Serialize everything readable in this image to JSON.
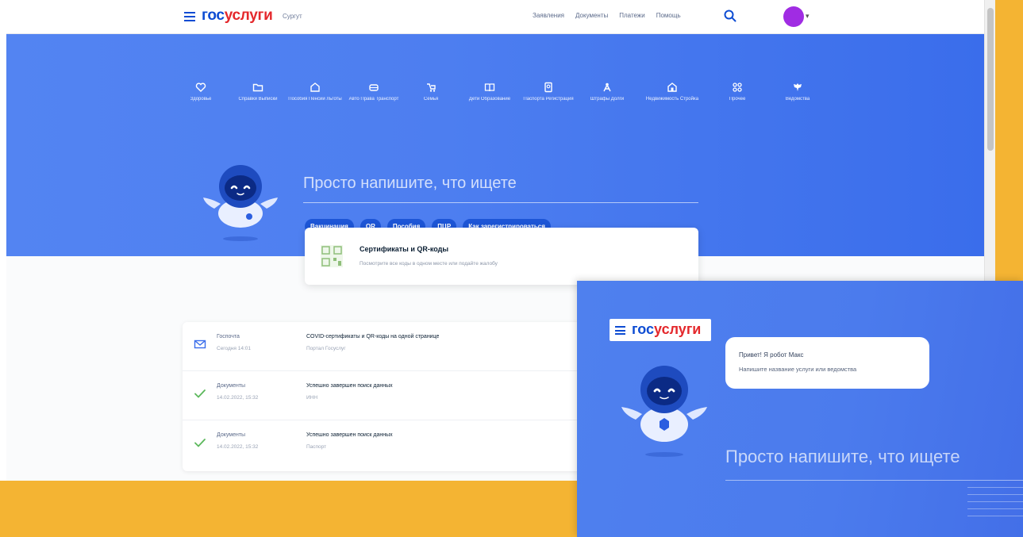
{
  "header": {
    "logo_part1": "гос",
    "logo_part2": "услуги",
    "city": "Сургут",
    "nav": [
      "Заявления",
      "Документы",
      "Платежи",
      "Помощь"
    ]
  },
  "categories": [
    {
      "label": "Здоровье",
      "icon": "heart-icon"
    },
    {
      "label": "Справки Выписки",
      "icon": "folder-icon"
    },
    {
      "label": "Пособия Пенсии Льготы",
      "icon": "house-icon"
    },
    {
      "label": "Авто Права Транспорт",
      "icon": "car-icon"
    },
    {
      "label": "Семья",
      "icon": "stroller-icon"
    },
    {
      "label": "Дети Образование",
      "icon": "book-icon"
    },
    {
      "label": "Паспорта Регистрация",
      "icon": "passport-icon"
    },
    {
      "label": "Штрафы Долги",
      "icon": "fine-icon"
    },
    {
      "label": "Недвижимость Стройка",
      "icon": "building-icon"
    },
    {
      "label": "Прочее",
      "icon": "grid-icon"
    },
    {
      "label": "Ведомства",
      "icon": "emblem-icon"
    }
  ],
  "hero": {
    "search_prompt": "Просто напишите, что ищете",
    "chips": [
      "Вакцинация",
      "QR",
      "Пособия",
      "ПЦР",
      "Как зарегистрироваться"
    ]
  },
  "cert_card": {
    "title": "Сертификаты и QR-коды",
    "subtitle": "Посмотрите все коды в одном месте или подайте жалобу"
  },
  "feed": [
    {
      "source": "Госпочта",
      "time": "Сегодня 14:01",
      "title": "COVID-сертификаты и QR-коды на одной странице",
      "subtitle": "Портал Госуслуг",
      "icon": "mail-icon"
    },
    {
      "source": "Документы",
      "time": "14.02.2022, 15:32",
      "title": "Успешно завершен поиск данных",
      "subtitle": "ИНН",
      "icon": "check-icon"
    },
    {
      "source": "Документы",
      "time": "14.02.2022, 15:32",
      "title": "Успешно завершен поиск данных",
      "subtitle": "Паспорт",
      "icon": "check-icon"
    }
  ],
  "overlay": {
    "logo_part1": "гос",
    "logo_part2": "услуги",
    "bubble_line1": "Привет! Я робот Макс",
    "bubble_line2": "Напишите название услуги или ведомства",
    "search_prompt": "Просто напишите, что ищете"
  },
  "colors": {
    "brand_blue": "#0d4cd3",
    "brand_red": "#e4282c",
    "hero_blue": "#4d7ef0",
    "accent_orange": "#f4b433",
    "avatar_purple": "#a02ce3"
  }
}
